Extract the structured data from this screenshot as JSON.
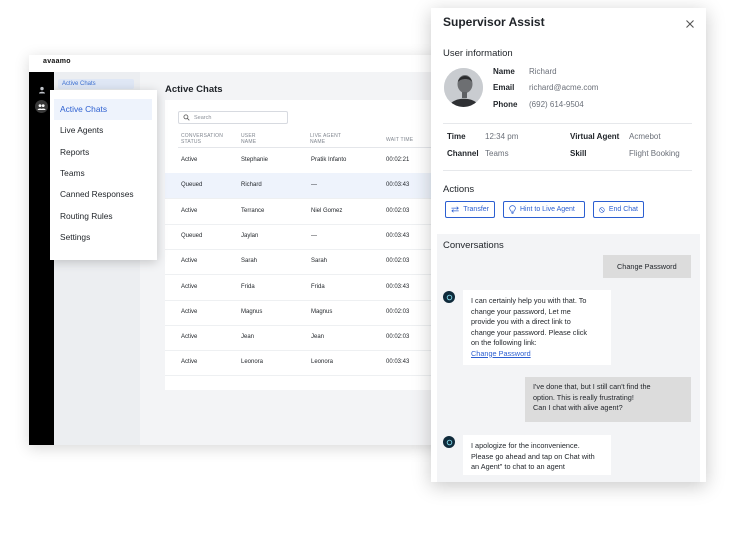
{
  "app": {
    "brand": "avaamo",
    "subnav_ghost": "Active Chats",
    "main_title": "Active Chats",
    "search_placeholder": "Search",
    "columns": [
      "CONVERSATION STATUS",
      "USER NAME",
      "LIVE AGENT NAME",
      "WAIT TIME"
    ],
    "rows": [
      {
        "status": "Active",
        "user": "Stephanie",
        "agent": "Pratik Infanto",
        "wait": "00:02:21",
        "highlight": false
      },
      {
        "status": "Queued",
        "user": "Richard",
        "agent": "—",
        "wait": "00:03:43",
        "highlight": true
      },
      {
        "status": "Active",
        "user": "Terrance",
        "agent": "Niel Gomez",
        "wait": "00:02:03",
        "highlight": false
      },
      {
        "status": "Queued",
        "user": "Jaylan",
        "agent": "—",
        "wait": "00:03:43",
        "highlight": false
      },
      {
        "status": "Active",
        "user": "Sarah",
        "agent": "Sarah",
        "wait": "00:02:03",
        "highlight": false
      },
      {
        "status": "Active",
        "user": "Frida",
        "agent": "Frida",
        "wait": "00:03:43",
        "highlight": false
      },
      {
        "status": "Active",
        "user": "Magnus",
        "agent": "Magnus",
        "wait": "00:02:03",
        "highlight": false
      },
      {
        "status": "Active",
        "user": "Jean",
        "agent": "Jean",
        "wait": "00:02:03",
        "highlight": false
      },
      {
        "status": "Active",
        "user": "Leonora",
        "agent": "Leonora",
        "wait": "00:03:43",
        "highlight": false
      }
    ]
  },
  "menu": {
    "items": [
      {
        "label": "Active Chats",
        "active": true
      },
      {
        "label": "Live Agents",
        "active": false
      },
      {
        "label": "Reports",
        "active": false
      },
      {
        "label": "Teams",
        "active": false
      },
      {
        "label": "Canned Responses",
        "active": false
      },
      {
        "label": "Routing Rules",
        "active": false
      },
      {
        "label": "Settings",
        "active": false
      }
    ]
  },
  "panel": {
    "title": "Supervisor Assist",
    "user_info_title": "User information",
    "name_label": "Name",
    "name_value": "Richard",
    "email_label": "Email",
    "email_value": "richard@acme.com",
    "phone_label": "Phone",
    "phone_value": "(692) 614-9504",
    "time_label": "Time",
    "time_value": "12:34 pm",
    "channel_label": "Channel",
    "channel_value": "Teams",
    "virtual_agent_label": "Virtual Agent",
    "virtual_agent_value": "Acmebot",
    "skill_label": "Skill",
    "skill_value": "Flight Booking",
    "actions_title": "Actions",
    "btn_transfer": "Transfer",
    "btn_hint": "Hint to Live Agent",
    "btn_end": "End Chat",
    "conversations_title": "Conversations",
    "messages": {
      "u1": "Change Password",
      "b1_lines": [
        "I can certainly help you with that. To",
        "change your password, Let me",
        "provide you with a direct link to",
        "change your password. Please click",
        "on the following link:"
      ],
      "b1_link": "Change Password",
      "u2_lines": [
        "I've done that, but I still can't find the",
        "option. This is really frustrating!",
        "Can I chat with alive agent?"
      ],
      "b2_lines": [
        "I apologize for the inconvenience.",
        "Please go ahead and tap on Chat with",
        "an Agent\" to chat to an agent"
      ]
    }
  },
  "colors": {
    "accent": "#2c5fd1",
    "highlight_row": "#eef3fc",
    "rail": "#000000"
  }
}
